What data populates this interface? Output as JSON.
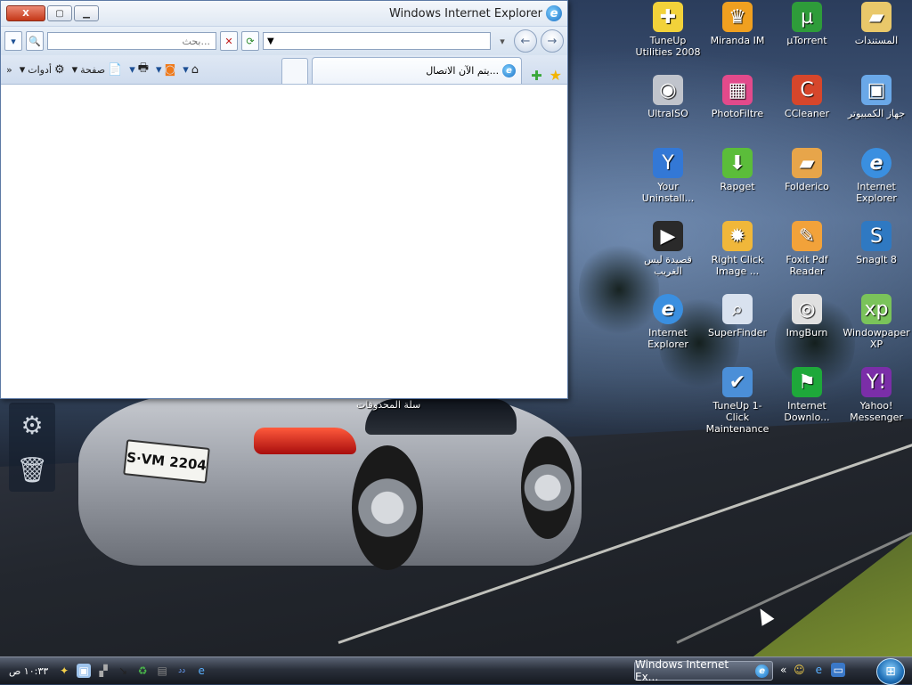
{
  "ie": {
    "title": "Windows Internet Explorer",
    "search_placeholder": "بحث...",
    "tab_label": "يتم الآن الاتصال...",
    "toolbar": {
      "tools": "أدوات",
      "page": "صفحة",
      "more": "»"
    },
    "window_buttons": {
      "close": "X"
    }
  },
  "desktop_icons": [
    {
      "label": "المستندات",
      "icon": "folder-icon",
      "color": "#e9c86a"
    },
    {
      "label": "µTorrent",
      "icon": "utorrent-icon",
      "color": "#2e9c3a"
    },
    {
      "label": "Miranda IM",
      "icon": "miranda-icon",
      "color": "#f0a020"
    },
    {
      "label": "TuneUp Utilities 2008",
      "icon": "tuneup-icon",
      "color": "#f2d23a"
    },
    {
      "label": "جهاز الكمبيوتر",
      "icon": "computer-icon",
      "color": "#6aa8e8"
    },
    {
      "label": "CCleaner",
      "icon": "ccleaner-icon",
      "color": "#d6462b"
    },
    {
      "label": "PhotoFiltre",
      "icon": "photofiltre-icon",
      "color": "#e24a8b"
    },
    {
      "label": "UltraISO",
      "icon": "disc-icon",
      "color": "#c0c4cc"
    },
    {
      "label": "Internet Explorer",
      "icon": "ie-icon",
      "color": "#3a8fe0"
    },
    {
      "label": "Folderico",
      "icon": "folderico-icon",
      "color": "#e7a54a"
    },
    {
      "label": "Rapget",
      "icon": "download-arrow-icon",
      "color": "#5bbd3a"
    },
    {
      "label": "Your Uninstall...",
      "icon": "uninstaller-icon",
      "color": "#3378d6"
    },
    {
      "label": "SnagIt 8",
      "icon": "snagit-icon",
      "color": "#2f79c2"
    },
    {
      "label": "Foxit Pdf Reader",
      "icon": "foxit-icon",
      "color": "#f2a23a"
    },
    {
      "label": "Right Click Image ...",
      "icon": "gear-sun-icon",
      "color": "#f0b73a"
    },
    {
      "label": "قصيدة ليس الغريب",
      "icon": "realplayer-icon",
      "color": "#2a2a2a"
    },
    {
      "label": "Windowpaper XP",
      "icon": "windowpaper-icon",
      "color": "#7ac35a"
    },
    {
      "label": "ImgBurn",
      "icon": "imgburn-icon",
      "color": "#e0e0e0"
    },
    {
      "label": "SuperFinder",
      "icon": "magnifier-icon",
      "color": "#d9e2ef"
    },
    {
      "label": "Internet Explorer",
      "icon": "ie-icon",
      "color": "#3a8fe0"
    },
    {
      "label": "Yahoo! Messenger",
      "icon": "yahoo-icon",
      "color": "#7b2ea8"
    },
    {
      "label": "Internet Downlo...",
      "icon": "flag-icon",
      "color": "#1ea83a"
    },
    {
      "label": "TuneUp 1-Click Maintenance",
      "icon": "tuneup-maint-icon",
      "color": "#4b8fd8"
    }
  ],
  "gadget_caption": "سلة المحذوفات",
  "taskbar": {
    "clock": "١٠:٣٣ ص",
    "task_button": "Windows Internet Ex...",
    "overflow": "«"
  },
  "car": {
    "plate": "S·VM 2204"
  }
}
